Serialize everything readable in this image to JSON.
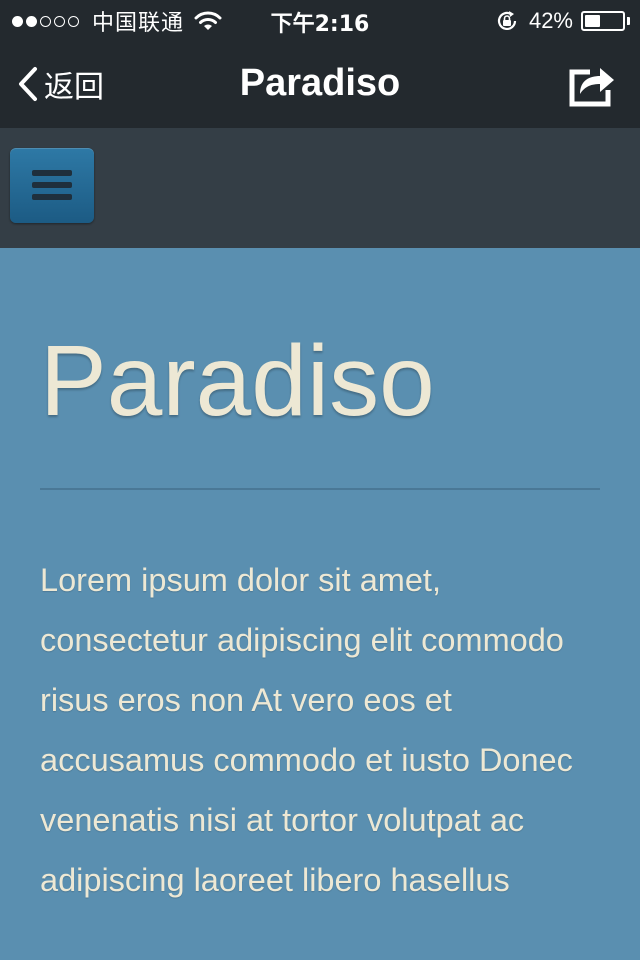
{
  "status_bar": {
    "signal_full": 2,
    "signal_total": 5,
    "carrier": "中国联通",
    "time": "下午2:16",
    "battery_percent": "42%",
    "battery_level": 0.42,
    "icons": [
      "wifi-icon",
      "rotation-lock-icon",
      "battery-icon"
    ]
  },
  "nav": {
    "back_label": "返回",
    "title": "Paradiso",
    "share_icon": "share-icon"
  },
  "header": {
    "menu_icon": "hamburger-menu-icon",
    "colors": {
      "background": "#343e46",
      "menu_button": "#236a96"
    }
  },
  "content": {
    "heading": "Paradiso",
    "body": "Lorem ipsum dolor sit amet, consectetur adipiscing elit commodo risus eros non At vero eos et accusamus commodo et iusto Donec venenatis nisi at tortor volutpat ac adipiscing laoreet libero hasellus",
    "colors": {
      "background": "#5a8fb0",
      "text": "#ede8d4"
    }
  }
}
